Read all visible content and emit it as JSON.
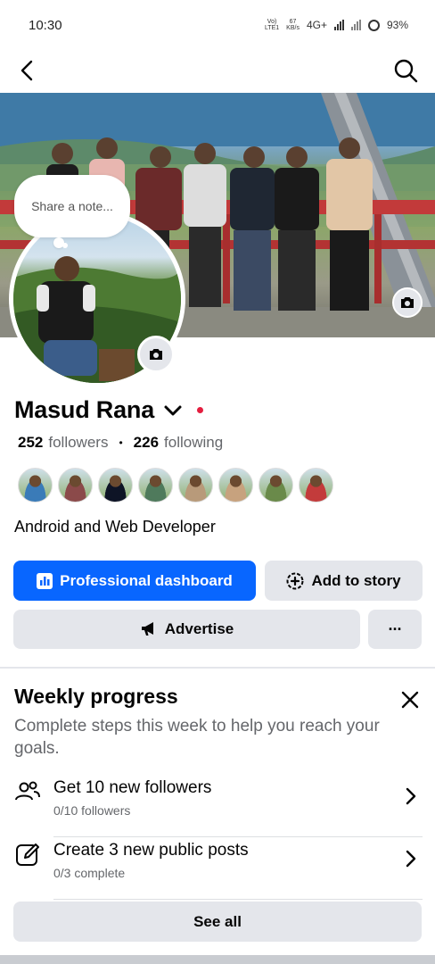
{
  "status_bar": {
    "time": "10:30",
    "net_top": "Vo)",
    "net_bottom": "LTE1",
    "speed_top": "67",
    "speed_bottom": "KB/s",
    "network": "4G+",
    "battery": "93%"
  },
  "app_bar": {
    "back_icon": "arrow-left-icon",
    "search_icon": "search-icon"
  },
  "profile": {
    "note_placeholder": "Share a note...",
    "name": "Masud Rana",
    "followers_count": "252",
    "followers_label": "followers",
    "following_count": "226",
    "following_label": "following",
    "separator": "•",
    "bio": "Android and Web Developer",
    "friend_avatar_colors": [
      "#3a7bb8",
      "#8b4a4a",
      "#0e1426",
      "#4f7a5c",
      "#b89a7a",
      "#c7a27e",
      "#6a8a4a",
      "#c33b3b"
    ]
  },
  "actions": {
    "professional_dashboard": "Professional dashboard",
    "add_to_story": "Add to story",
    "advertise": "Advertise",
    "more": "···"
  },
  "weekly_progress": {
    "title": "Weekly progress",
    "subtitle": "Complete steps this week to help you reach your goals.",
    "tasks": [
      {
        "title": "Get 10 new followers",
        "progress": "0/10 followers",
        "icon": "people-icon"
      },
      {
        "title": "Create 3 new public posts",
        "progress": "0/3 complete",
        "icon": "edit-icon"
      }
    ],
    "see_all": "See all"
  },
  "colors": {
    "primary": "#0866ff",
    "button_gray": "#e4e6eb",
    "secondary_text": "#65676b",
    "online_dot": "#e41e3f"
  }
}
